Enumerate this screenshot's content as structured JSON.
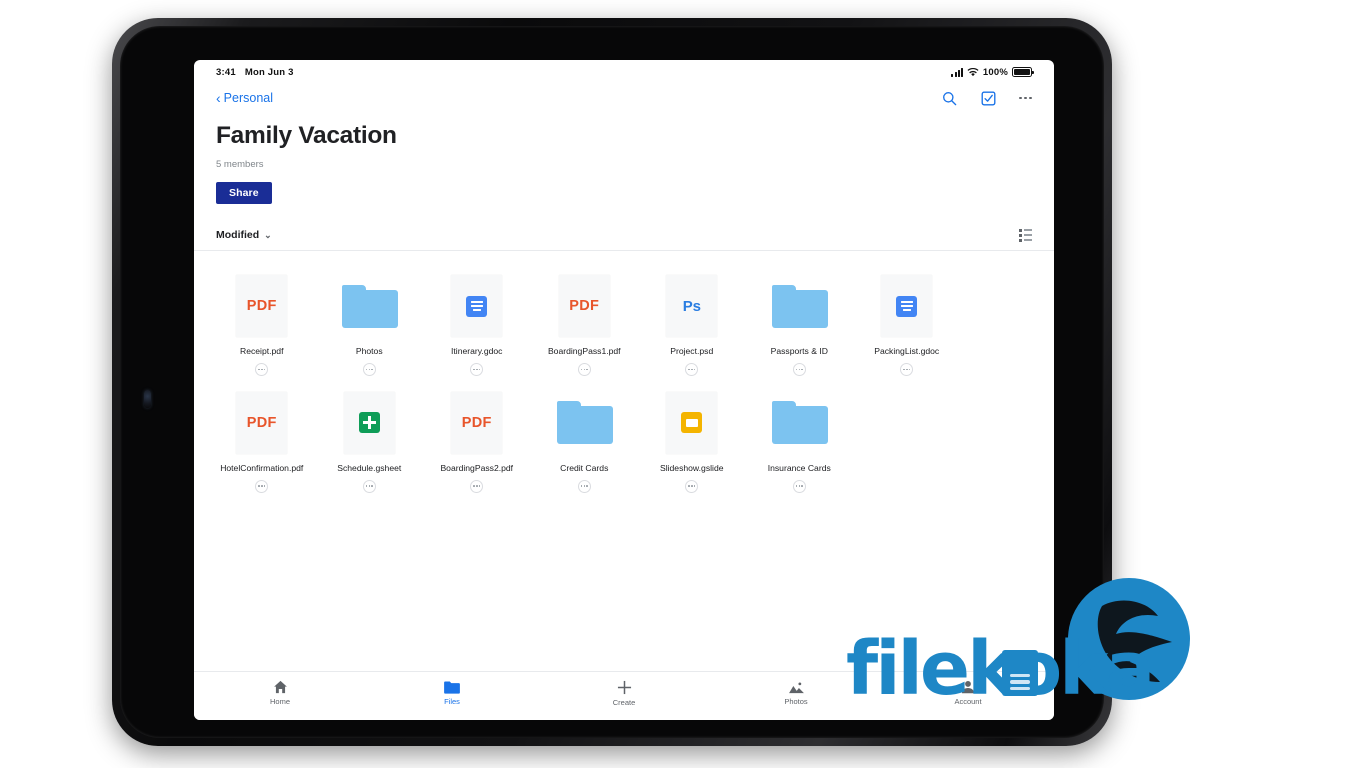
{
  "status_bar": {
    "time": "3:41",
    "date": "Mon Jun 3",
    "battery_percent": "100%",
    "signal_icon": "cellular-bars-icon",
    "wifi_icon": "wifi-icon",
    "battery_icon": "battery-icon"
  },
  "nav": {
    "back_label": "Personal",
    "back_chevron": "‹",
    "search_icon": "search-icon",
    "select_icon": "select-checkbox-icon",
    "more_icon": "more-options-icon"
  },
  "header": {
    "title": "Family Vacation",
    "members": "5 members",
    "share_label": "Share"
  },
  "sort_bar": {
    "sort_label": "Modified",
    "chevron": "⌄",
    "view_toggle_icon": "list-view-icon"
  },
  "files": [
    {
      "name": "Receipt.pdf",
      "type": "pdf",
      "badge": "PDF"
    },
    {
      "name": "Photos",
      "type": "folder",
      "badge": ""
    },
    {
      "name": "Itinerary.gdoc",
      "type": "gdoc",
      "badge": ""
    },
    {
      "name": "BoardingPass1.pdf",
      "type": "pdf",
      "badge": "PDF"
    },
    {
      "name": "Project.psd",
      "type": "psd",
      "badge": "Ps"
    },
    {
      "name": "Passports & ID",
      "type": "folder",
      "badge": ""
    },
    {
      "name": "PackingList.gdoc",
      "type": "gdoc",
      "badge": ""
    },
    {
      "name": "HotelConfirmation.pdf",
      "type": "pdf",
      "badge": "PDF"
    },
    {
      "name": "Schedule.gsheet",
      "type": "gsheet",
      "badge": ""
    },
    {
      "name": "BoardingPass2.pdf",
      "type": "pdf",
      "badge": "PDF"
    },
    {
      "name": "Credit Cards",
      "type": "folder",
      "badge": ""
    },
    {
      "name": "Slideshow.gslide",
      "type": "gslide",
      "badge": ""
    },
    {
      "name": "Insurance Cards",
      "type": "folder",
      "badge": ""
    }
  ],
  "bottom_nav": [
    {
      "label": "Home",
      "icon": "home-icon",
      "active": false
    },
    {
      "label": "Files",
      "icon": "folder-icon",
      "active": true
    },
    {
      "label": "Create",
      "icon": "plus-icon",
      "active": false
    },
    {
      "label": "Photos",
      "icon": "photos-icon",
      "active": false
    },
    {
      "label": "Account",
      "icon": "account-icon",
      "active": false
    }
  ],
  "watermark": {
    "text": "filekoka",
    "logo_icon": "filekoka-bird-logo",
    "color": "#1e87c6"
  },
  "colors": {
    "accent_blue": "#1a73e8",
    "share_button": "#1a2d96",
    "folder_blue": "#7cc3f0",
    "pdf_red": "#e8552b",
    "psd_blue": "#2a7de1",
    "gdoc_blue": "#4285f4",
    "gsheet_green": "#0f9d58",
    "gslide_yellow": "#f4b400"
  }
}
